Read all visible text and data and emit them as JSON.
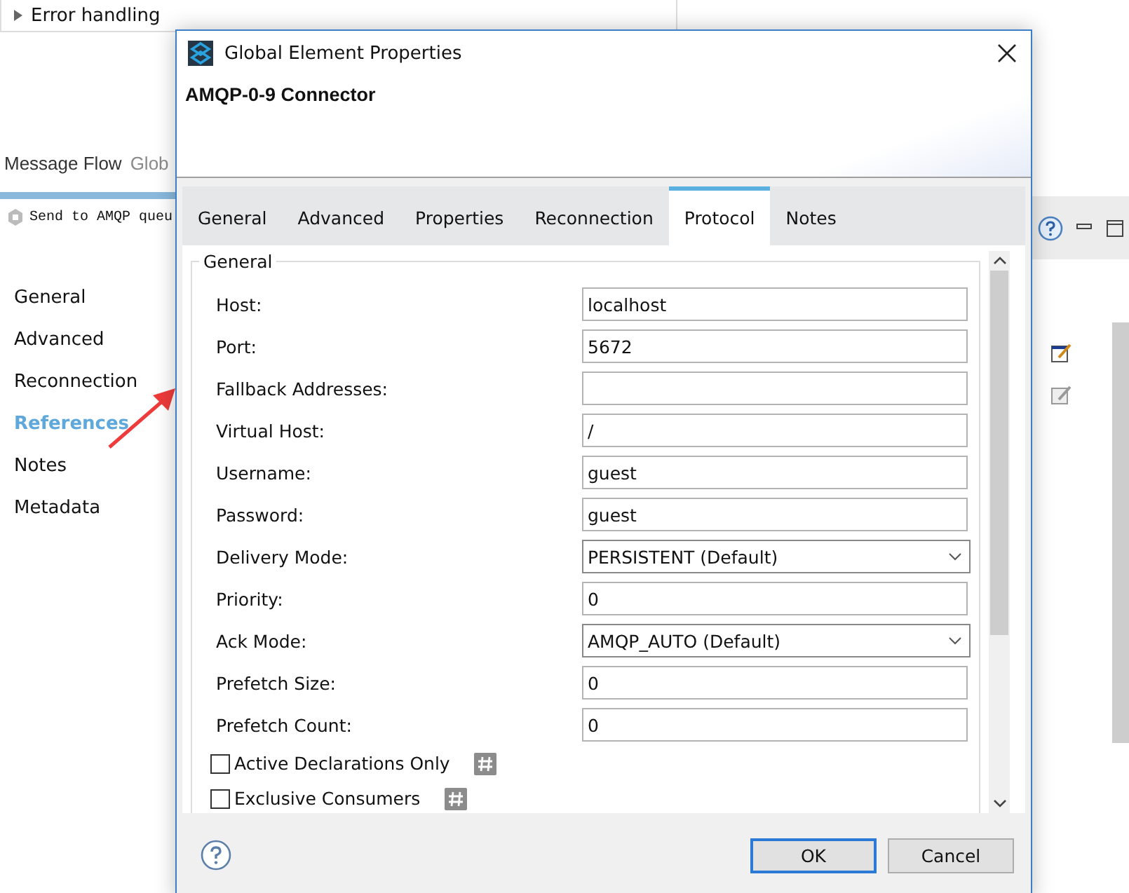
{
  "background": {
    "outline_item": "Error handling",
    "editor_tabs": [
      {
        "label": "Message Flow",
        "selected": true
      },
      {
        "label": "Glob",
        "selected": false
      }
    ],
    "node_title": "Send to AMQP queu",
    "sidebar": [
      {
        "label": "General",
        "selected": false
      },
      {
        "label": "Advanced",
        "selected": false
      },
      {
        "label": "Reconnection",
        "selected": false
      },
      {
        "label": "References",
        "selected": true
      },
      {
        "label": "Notes",
        "selected": false
      },
      {
        "label": "Metadata",
        "selected": false
      }
    ]
  },
  "dialog": {
    "title": "Global Element Properties",
    "heading": "AMQP-0-9 Connector",
    "tabs": [
      {
        "label": "General",
        "selected": false
      },
      {
        "label": "Advanced",
        "selected": false
      },
      {
        "label": "Properties",
        "selected": false
      },
      {
        "label": "Reconnection",
        "selected": false
      },
      {
        "label": "Protocol",
        "selected": true
      },
      {
        "label": "Notes",
        "selected": false
      }
    ],
    "group": "General",
    "fields": [
      {
        "label": "Host:",
        "kind": "text",
        "value": "localhost"
      },
      {
        "label": "Port:",
        "kind": "text",
        "value": "5672"
      },
      {
        "label": "Fallback Addresses:",
        "kind": "text"
      },
      {
        "label": "Virtual Host:",
        "kind": "text",
        "value": "/"
      },
      {
        "label": "Username:",
        "kind": "text",
        "value": "guest"
      },
      {
        "label": "Password:",
        "kind": "text",
        "value": "guest"
      },
      {
        "label": "Delivery Mode:",
        "kind": "select",
        "value": "PERSISTENT (Default)"
      },
      {
        "label": "Priority:",
        "kind": "text",
        "value": "0"
      },
      {
        "label": "Ack Mode:",
        "kind": "select",
        "value": "AMQP_AUTO (Default)"
      },
      {
        "label": "Prefetch Size:",
        "kind": "text",
        "value": "0"
      },
      {
        "label": "Prefetch Count:",
        "kind": "text",
        "value": "0"
      }
    ],
    "checkboxes": [
      {
        "label": "Active Declarations Only",
        "checked": false
      },
      {
        "label": "Exclusive Consumers",
        "checked": false
      }
    ],
    "buttons": [
      {
        "label": "OK",
        "default": true
      },
      {
        "label": "Cancel",
        "default": false
      }
    ]
  }
}
